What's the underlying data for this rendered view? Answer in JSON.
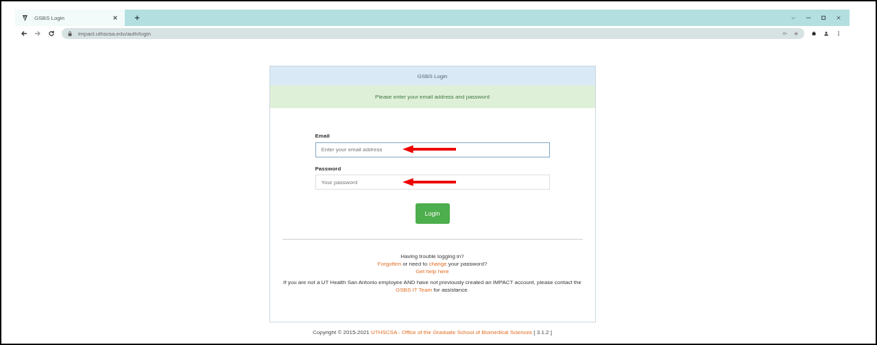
{
  "browser": {
    "tab_title": "GSBS Login",
    "url": "impact.uthscsa.edu/auth/login"
  },
  "card": {
    "title": "GSBS Login",
    "message": "Please enter your email address and password",
    "fields": [
      {
        "label": "Email",
        "placeholder": "Enter your email address",
        "focused": true
      },
      {
        "label": "Password",
        "placeholder": "Your password",
        "focused": false
      }
    ],
    "button": "Login",
    "help": {
      "line_1": "Having trouble logging in?",
      "link_1": "Forgotten",
      "middle": "or need to",
      "link_2": "change",
      "end": "your password?",
      "link_3": "Get help here",
      "note": "If you are not a UT Health San Antonio employee AND have not previously created an IMPACT account, please contact the",
      "link_4": "GSBS IT Team",
      "note_end": "for assistance."
    }
  },
  "footer": {
    "prefix": "Copyright © 2015-2021",
    "link": "UTHSCSA - Office of the Graduate School of Biomedical Sciences",
    "suffix": "[ 3.1.2 ]"
  }
}
